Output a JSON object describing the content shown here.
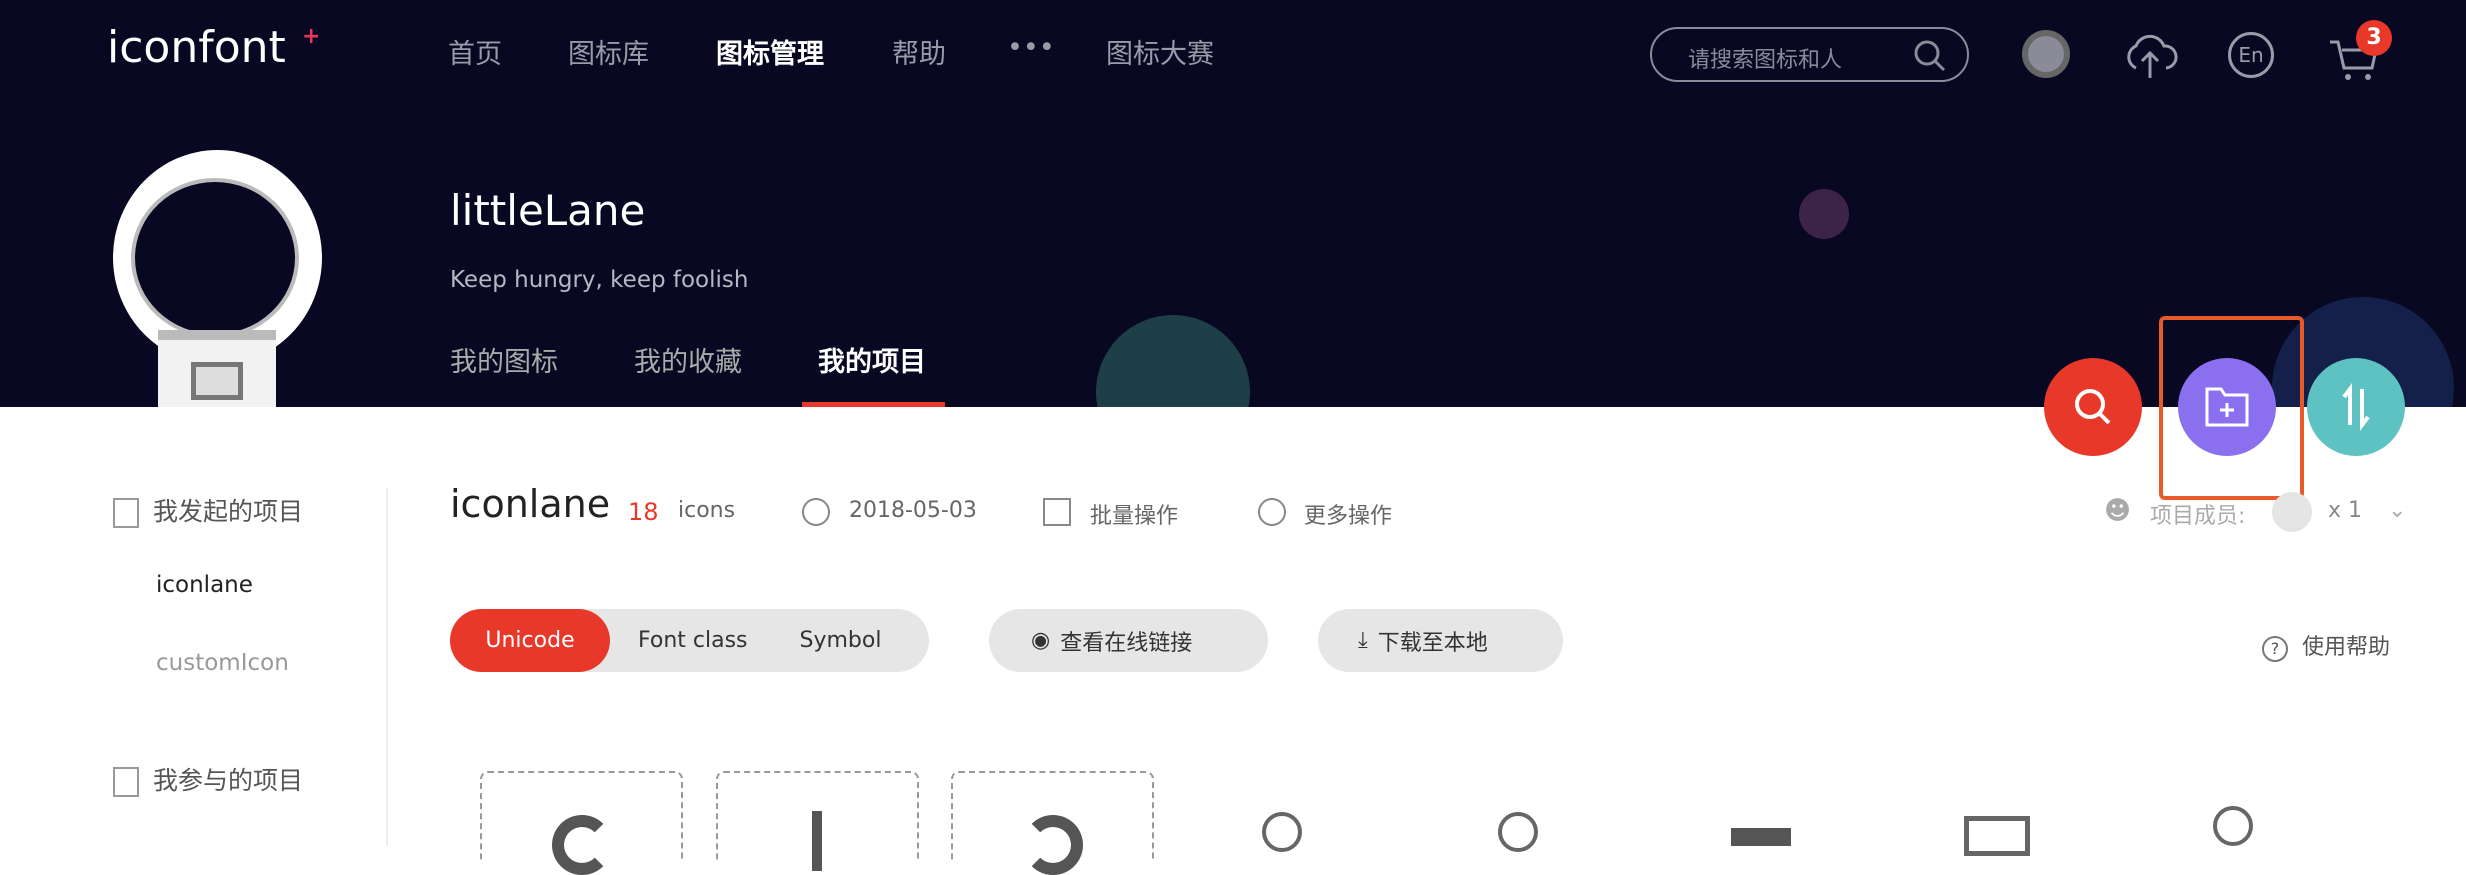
{
  "header": {
    "logo": "iconfont",
    "nav": [
      "首页",
      "图标库",
      "图标管理",
      "帮助",
      "•••",
      "图标大赛"
    ],
    "search_placeholder": "请搜索图标和人",
    "lang": "En",
    "cart_count": "3"
  },
  "profile": {
    "name": "littleLane",
    "tagline": "Keep hungry, keep foolish",
    "tabs": [
      "我的图标",
      "我的收藏",
      "我的项目"
    ]
  },
  "sidebar": {
    "created_heading": "我发起的项目",
    "projects": [
      "iconlane",
      "customIcon"
    ],
    "joined_heading": "我参与的项目"
  },
  "project": {
    "name": "iconlane",
    "count": "18",
    "count_unit": "icons",
    "date": "2018-05-03",
    "batch": "批量操作",
    "more": "更多操作",
    "members_label": "项目成员:",
    "members_count": "x 1"
  },
  "toolbar": {
    "modes": [
      "Unicode",
      "Font class",
      "Symbol"
    ],
    "view_link": "查看在线链接",
    "download": "下载至本地",
    "help": "使用帮助"
  },
  "colors": {
    "accent": "#e8382a",
    "purple": "#8a70ee",
    "teal": "#5ec2c2",
    "hero": "#080822"
  }
}
